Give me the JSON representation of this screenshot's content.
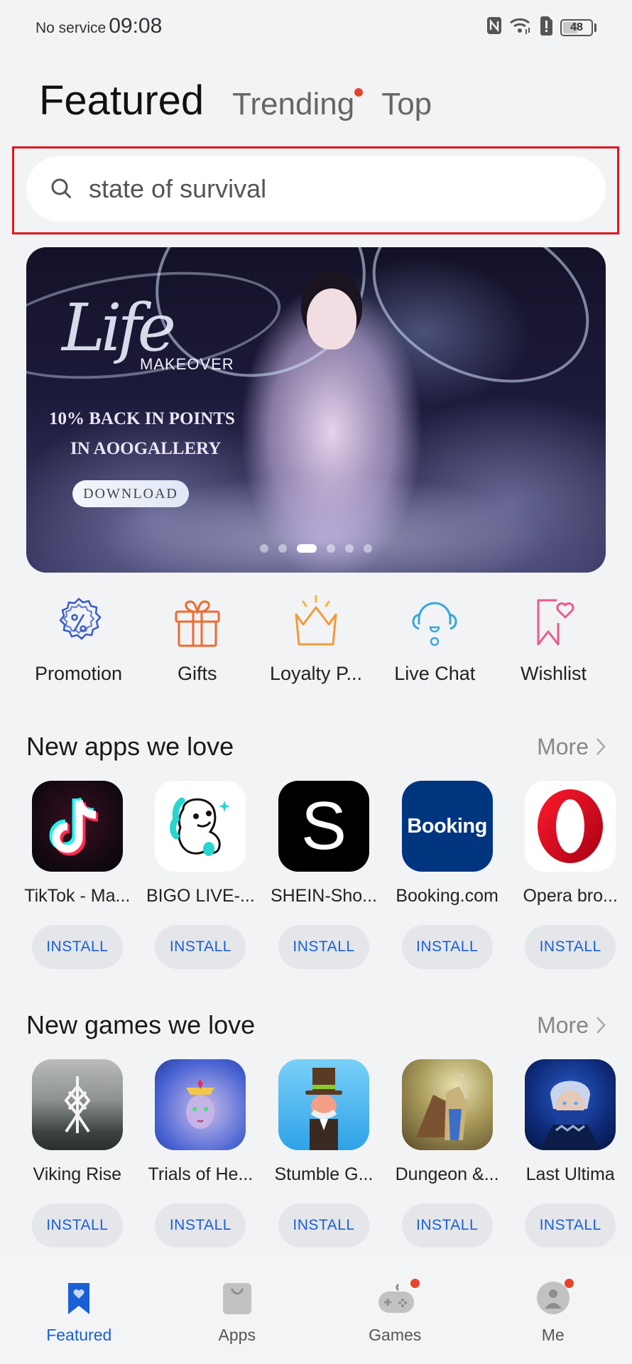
{
  "status_bar": {
    "carrier": "No service",
    "time": "09:08",
    "icons": [
      "nfc-icon",
      "wifi-icon",
      "sim-alert-icon",
      "battery-icon"
    ],
    "battery_level": "48"
  },
  "tabs": [
    {
      "label": "Featured",
      "active": true,
      "badge": false
    },
    {
      "label": "Trending",
      "active": false,
      "badge": true
    },
    {
      "label": "Top",
      "active": false,
      "badge": false
    }
  ],
  "search": {
    "value": "state of survival",
    "icon": "search-icon"
  },
  "banner": {
    "logo": "Life",
    "subtitle": "MAKEOVER",
    "promo_line1": "10% BACK IN POINTS",
    "promo_line2": "IN AOOGALLERY",
    "cta": "DOWNLOAD",
    "slide_count": 6,
    "active_slide": 3
  },
  "quick_links": [
    {
      "label": "Promotion",
      "icon": "promotion-badge-icon",
      "color": "#3a5bc7"
    },
    {
      "label": "Gifts",
      "icon": "gift-icon",
      "color": "#f06a30"
    },
    {
      "label": "Loyalty P...",
      "icon": "crown-icon",
      "color": "#f39a3a"
    },
    {
      "label": "Live Chat",
      "icon": "headset-icon",
      "color": "#3aa6dc"
    },
    {
      "label": "Wishlist",
      "icon": "bookmark-heart-icon",
      "color": "#ec5a8a"
    }
  ],
  "sections": [
    {
      "title": "New apps we love",
      "more_label": "More",
      "items": [
        {
          "name": "TikTok - Ma...",
          "icon": "tiktok-icon",
          "action": "INSTALL"
        },
        {
          "name": "BIGO LIVE-...",
          "icon": "bigo-live-icon",
          "action": "INSTALL"
        },
        {
          "name": "SHEIN-Sho...",
          "icon": "shein-icon",
          "action": "INSTALL"
        },
        {
          "name": "Booking.com",
          "icon": "booking-icon",
          "icon_text": "Booking",
          "action": "INSTALL"
        },
        {
          "name": "Opera bro...",
          "icon": "opera-icon",
          "action": "INSTALL"
        }
      ]
    },
    {
      "title": "New games we love",
      "more_label": "More",
      "items": [
        {
          "name": "Viking Rise",
          "icon": "viking-rise-icon",
          "action": "INSTALL"
        },
        {
          "name": "Trials of He...",
          "icon": "trials-of-heroes-icon",
          "action": "INSTALL"
        },
        {
          "name": "Stumble G...",
          "icon": "stumble-guys-icon",
          "action": "INSTALL"
        },
        {
          "name": "Dungeon &...",
          "icon": "dungeon-icon",
          "action": "INSTALL"
        },
        {
          "name": "Last Ultima",
          "icon": "last-ultima-icon",
          "action": "INSTALL"
        }
      ]
    }
  ],
  "bottom_nav": [
    {
      "label": "Featured",
      "icon": "featured-bookmark-icon",
      "active": true,
      "badge": false
    },
    {
      "label": "Apps",
      "icon": "shopping-bag-icon",
      "active": false,
      "badge": false
    },
    {
      "label": "Games",
      "icon": "gamepad-icon",
      "active": false,
      "badge": true
    },
    {
      "label": "Me",
      "icon": "profile-icon",
      "active": false,
      "badge": true
    }
  ],
  "colors": {
    "accent": "#1a5fd6",
    "badge": "#e8432a",
    "highlight_border": "#e6141d",
    "background": "#f1f3f5"
  }
}
